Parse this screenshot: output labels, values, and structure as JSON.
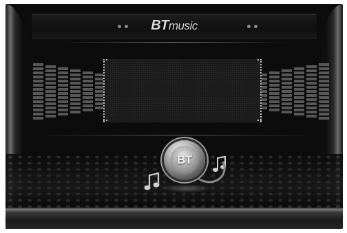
{
  "header": {
    "title_bold": "BT",
    "title_light": "music"
  },
  "status_dots": {
    "left_count": 2,
    "right_count": 2
  },
  "badge": {
    "label": "BT"
  },
  "icons": [
    "music-note-left-icon",
    "music-note-right-icon",
    "bluetooth-badge-icon"
  ],
  "colors": {
    "background": "#0c0c0c",
    "chrome": "#8a8a8a",
    "text": "#d9d9d9"
  }
}
